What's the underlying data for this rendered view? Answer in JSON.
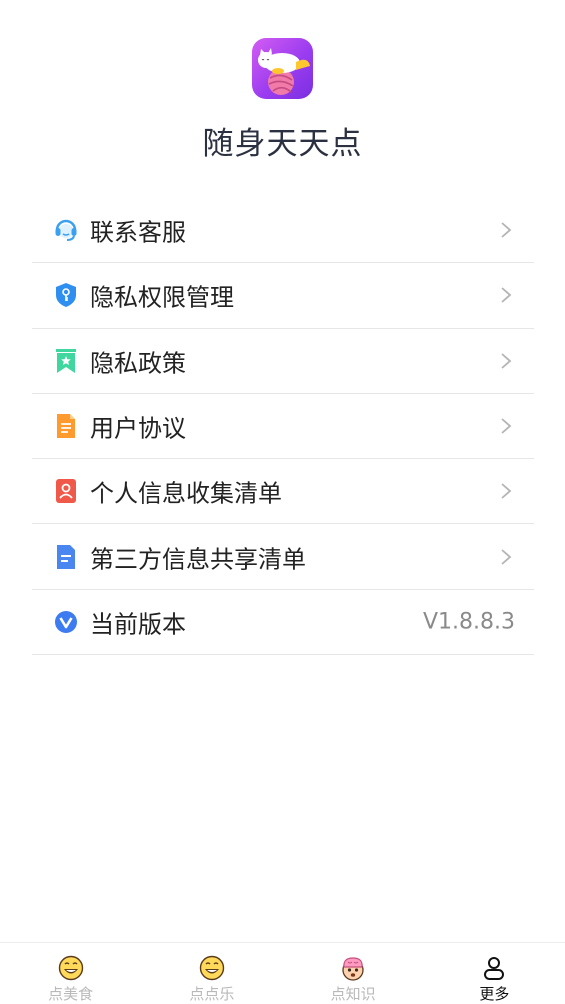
{
  "app": {
    "name": "随身天天点"
  },
  "menu": [
    {
      "icon": "headset-icon",
      "label": "联系客服"
    },
    {
      "icon": "shield-key-icon",
      "label": "隐私权限管理"
    },
    {
      "icon": "bookmark-star-icon",
      "label": "隐私政策"
    },
    {
      "icon": "document-icon",
      "label": "用户协议"
    },
    {
      "icon": "person-card-icon",
      "label": "个人信息收集清单"
    },
    {
      "icon": "file-icon",
      "label": "第三方信息共享清单"
    },
    {
      "icon": "version-icon",
      "label": "当前版本",
      "value": "V1.8.8.3"
    }
  ],
  "tabs": [
    {
      "label": "点美食",
      "icon": "smiley-icon",
      "active": false
    },
    {
      "label": "点点乐",
      "icon": "smiley-icon",
      "active": false
    },
    {
      "label": "点知识",
      "icon": "brain-face-icon",
      "active": false
    },
    {
      "label": "更多",
      "icon": "person-outline-icon",
      "active": true
    }
  ],
  "colors": {
    "logo_gradient": [
      "#d45cf2",
      "#7a2fe0"
    ],
    "headset": "#3aa0f0",
    "shield": "#2f8ff0",
    "bookmark": "#3fd6a0",
    "document": "#ff9a2e",
    "person_card": "#f0584a",
    "file": "#4a86f0",
    "version": "#3d7cf0",
    "chevron": "#b5b5b5"
  }
}
